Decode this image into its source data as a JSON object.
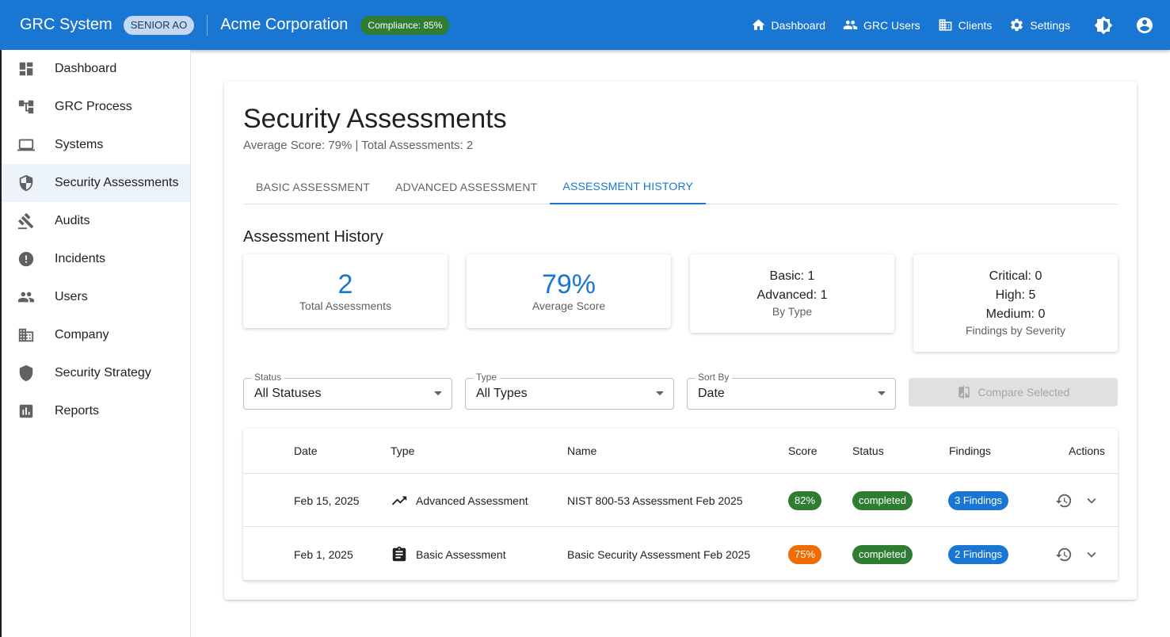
{
  "app": {
    "brand": "GRC System",
    "role": "SENIOR AO",
    "company": "Acme Corporation",
    "compliance": "Compliance: 85%"
  },
  "topnav": [
    {
      "label": "Dashboard",
      "icon": "home-icon"
    },
    {
      "label": "GRC Users",
      "icon": "people-icon"
    },
    {
      "label": "Clients",
      "icon": "building-icon"
    },
    {
      "label": "Settings",
      "icon": "gear-icon"
    }
  ],
  "sidebar": {
    "items": [
      {
        "label": "Dashboard",
        "icon": "dashboard-icon"
      },
      {
        "label": "GRC Process",
        "icon": "tree-icon"
      },
      {
        "label": "Systems",
        "icon": "laptop-icon"
      },
      {
        "label": "Security Assessments",
        "icon": "shield-icon",
        "active": true
      },
      {
        "label": "Audits",
        "icon": "gavel-icon"
      },
      {
        "label": "Incidents",
        "icon": "alert-icon"
      },
      {
        "label": "Users",
        "icon": "people-icon"
      },
      {
        "label": "Company",
        "icon": "building-icon"
      },
      {
        "label": "Security Strategy",
        "icon": "shield-solid-icon"
      },
      {
        "label": "Reports",
        "icon": "bar-chart-icon"
      }
    ]
  },
  "page": {
    "title": "Security Assessments",
    "subtitle": "Average Score: 79% | Total Assessments: 2",
    "tabs": [
      "BASIC ASSESSMENT",
      "ADVANCED ASSESSMENT",
      "ASSESSMENT HISTORY"
    ],
    "active_tab": "ASSESSMENT HISTORY",
    "section_title": "Assessment History"
  },
  "stats": {
    "total": {
      "value": "2",
      "caption": "Total Assessments"
    },
    "average": {
      "value": "79%",
      "caption": "Average Score"
    },
    "by_type": {
      "lines": [
        "Basic: 1",
        "Advanced: 1"
      ],
      "caption": "By Type"
    },
    "severity": {
      "lines": [
        "Critical: 0",
        "High: 5",
        "Medium: 0"
      ],
      "caption": "Findings by Severity"
    }
  },
  "filters": {
    "status": {
      "label": "Status",
      "value": "All Statuses"
    },
    "type": {
      "label": "Type",
      "value": "All Types"
    },
    "sort": {
      "label": "Sort By",
      "value": "Date"
    },
    "compare_label": "Compare Selected"
  },
  "table": {
    "headers": [
      "Date",
      "Type",
      "Name",
      "Score",
      "Status",
      "Findings",
      "Actions"
    ],
    "rows": [
      {
        "date": "Feb 15, 2025",
        "type": "Advanced Assessment",
        "type_icon": "trending-up-icon",
        "name": "NIST 800-53 Assessment Feb 2025",
        "score": "82%",
        "score_color": "#2e7d32",
        "status": "completed",
        "findings": "3 Findings"
      },
      {
        "date": "Feb 1, 2025",
        "type": "Basic Assessment",
        "type_icon": "clipboard-icon",
        "name": "Basic Security Assessment Feb 2025",
        "score": "75%",
        "score_color": "#ef6c00",
        "status": "completed",
        "findings": "2 Findings"
      }
    ]
  },
  "colors": {
    "primary": "#1976d2",
    "success": "#2e7d32",
    "warning": "#ef6c00"
  }
}
